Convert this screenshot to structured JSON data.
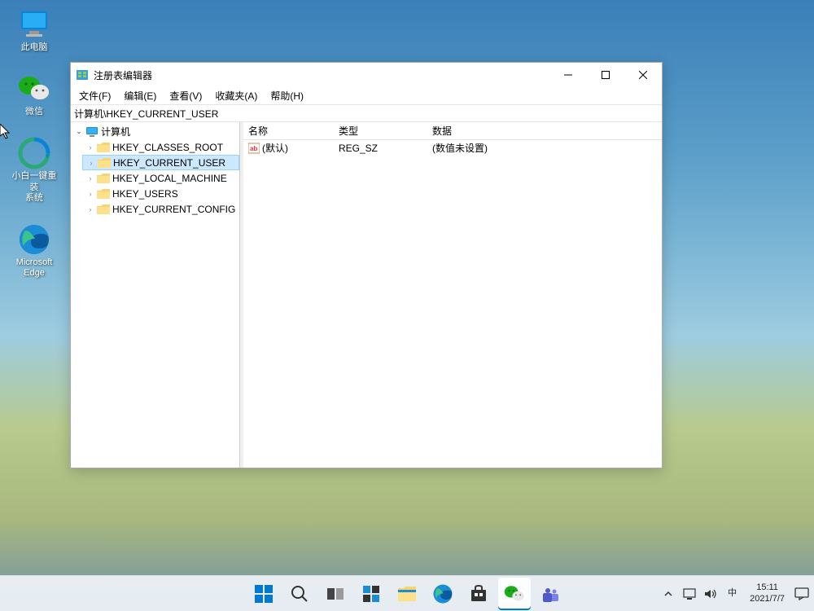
{
  "desktop": {
    "icons": [
      {
        "name": "this-pc",
        "label": "此电脑"
      },
      {
        "name": "wechat",
        "label": "微信"
      },
      {
        "name": "xiaobai",
        "label": "小白一键重装\n系统"
      },
      {
        "name": "edge",
        "label": "Microsoft\nEdge"
      }
    ]
  },
  "window": {
    "title": "注册表编辑器",
    "menu": [
      {
        "label": "文件(F)"
      },
      {
        "label": "编辑(E)"
      },
      {
        "label": "查看(V)"
      },
      {
        "label": "收藏夹(A)"
      },
      {
        "label": "帮助(H)"
      }
    ],
    "address": "计算机\\HKEY_CURRENT_USER",
    "tree": {
      "root": "计算机",
      "children": [
        {
          "label": "HKEY_CLASSES_ROOT"
        },
        {
          "label": "HKEY_CURRENT_USER",
          "selected": true
        },
        {
          "label": "HKEY_LOCAL_MACHINE"
        },
        {
          "label": "HKEY_USERS"
        },
        {
          "label": "HKEY_CURRENT_CONFIG"
        }
      ]
    },
    "columns": {
      "name": "名称",
      "type": "类型",
      "data": "数据"
    },
    "rows": [
      {
        "name": "(默认)",
        "type": "REG_SZ",
        "data": "(数值未设置)"
      }
    ]
  },
  "taskbar": {
    "ime": "中",
    "time": "15:11",
    "date": "2021/7/7"
  }
}
